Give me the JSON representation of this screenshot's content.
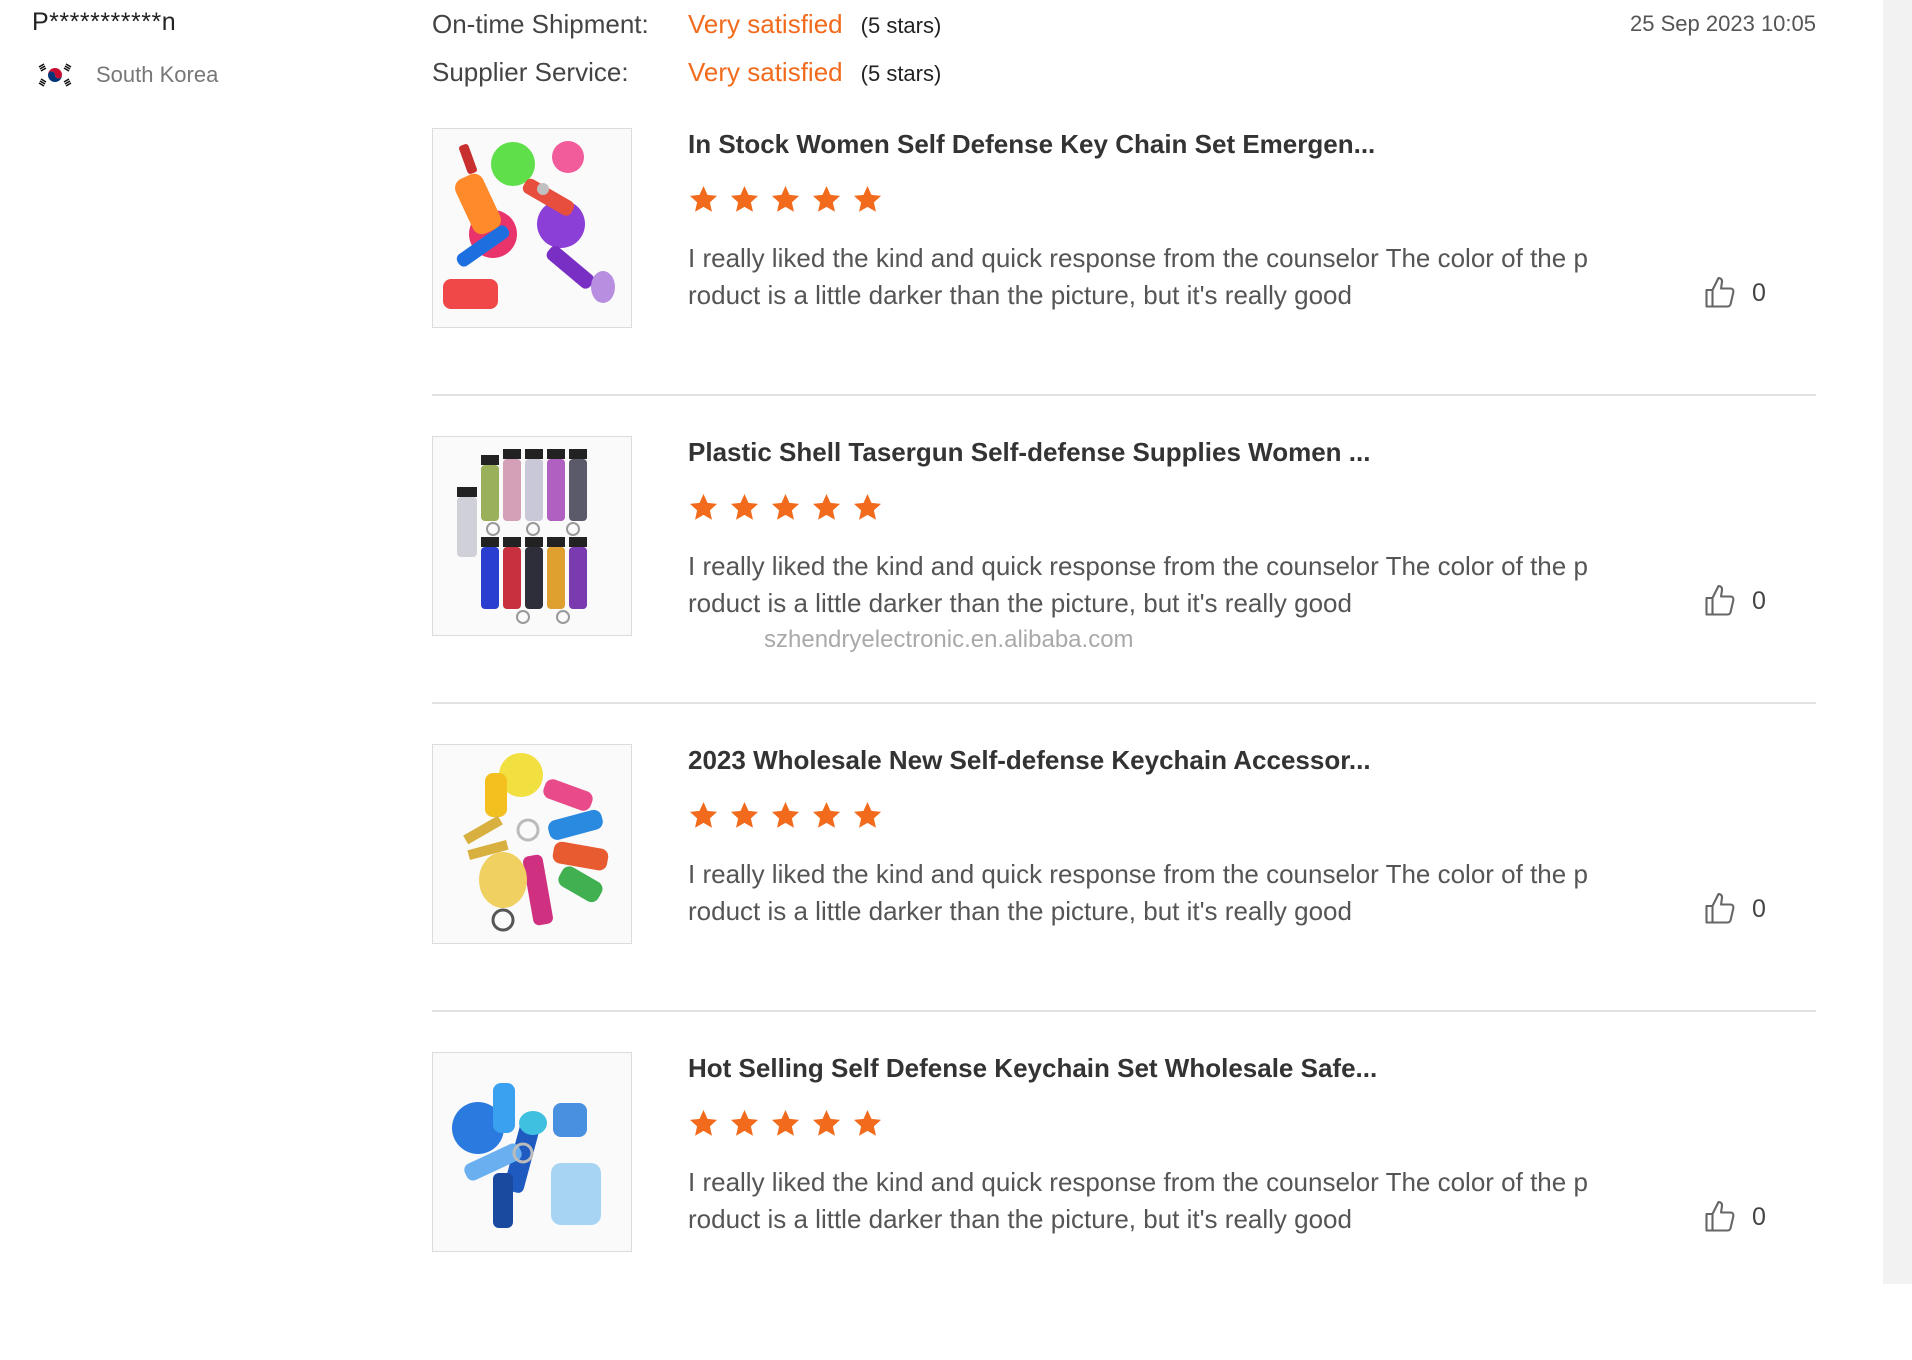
{
  "reviewer": {
    "name": "P***********n",
    "country": "South Korea",
    "flag_icon": "south-korea-flag-icon"
  },
  "ratings": [
    {
      "label": "On-time Shipment:",
      "value": "Very satisfied",
      "stars": "(5 stars)"
    },
    {
      "label": "Supplier Service:",
      "value": "Very satisfied",
      "stars": "(5 stars)"
    }
  ],
  "review_date": "25 Sep 2023 10:05",
  "watermark": "szhendryelectronic.en.alibaba.com",
  "colors": {
    "accent": "#f26b1d",
    "divider": "#e2e2e2"
  },
  "reviews": [
    {
      "product_title": "In Stock Women Self Defense Key Chain Set Emergen...",
      "rating": 5,
      "text": "I really liked the kind and quick response from the counselor The color of the product is a little darker than the picture, but it's really good",
      "likes": "0",
      "image_icon": "colorful-keychain-set-image"
    },
    {
      "product_title": "Plastic Shell Tasergun Self-defense Supplies Women ...",
      "rating": 5,
      "text": "I really liked the kind and quick response from the counselor The color of the product is a little darker than the picture, but it's really good",
      "likes": "0",
      "image_icon": "rhinestone-spray-bottles-image"
    },
    {
      "product_title": "2023 Wholesale New Self-defense Keychain Accessor...",
      "rating": 5,
      "text": "I really liked the kind and quick response from the counselor The color of the product is a little darker than the picture, but it's really good",
      "likes": "0",
      "image_icon": "tie-dye-keychain-set-image"
    },
    {
      "product_title": "Hot Selling Self Defense Keychain Set Wholesale Safe...",
      "rating": 5,
      "text": "I really liked the kind and quick response from the counselor The color of the product is a little darker than the picture, but it's really good",
      "likes": "0",
      "image_icon": "blue-keychain-set-image"
    }
  ]
}
